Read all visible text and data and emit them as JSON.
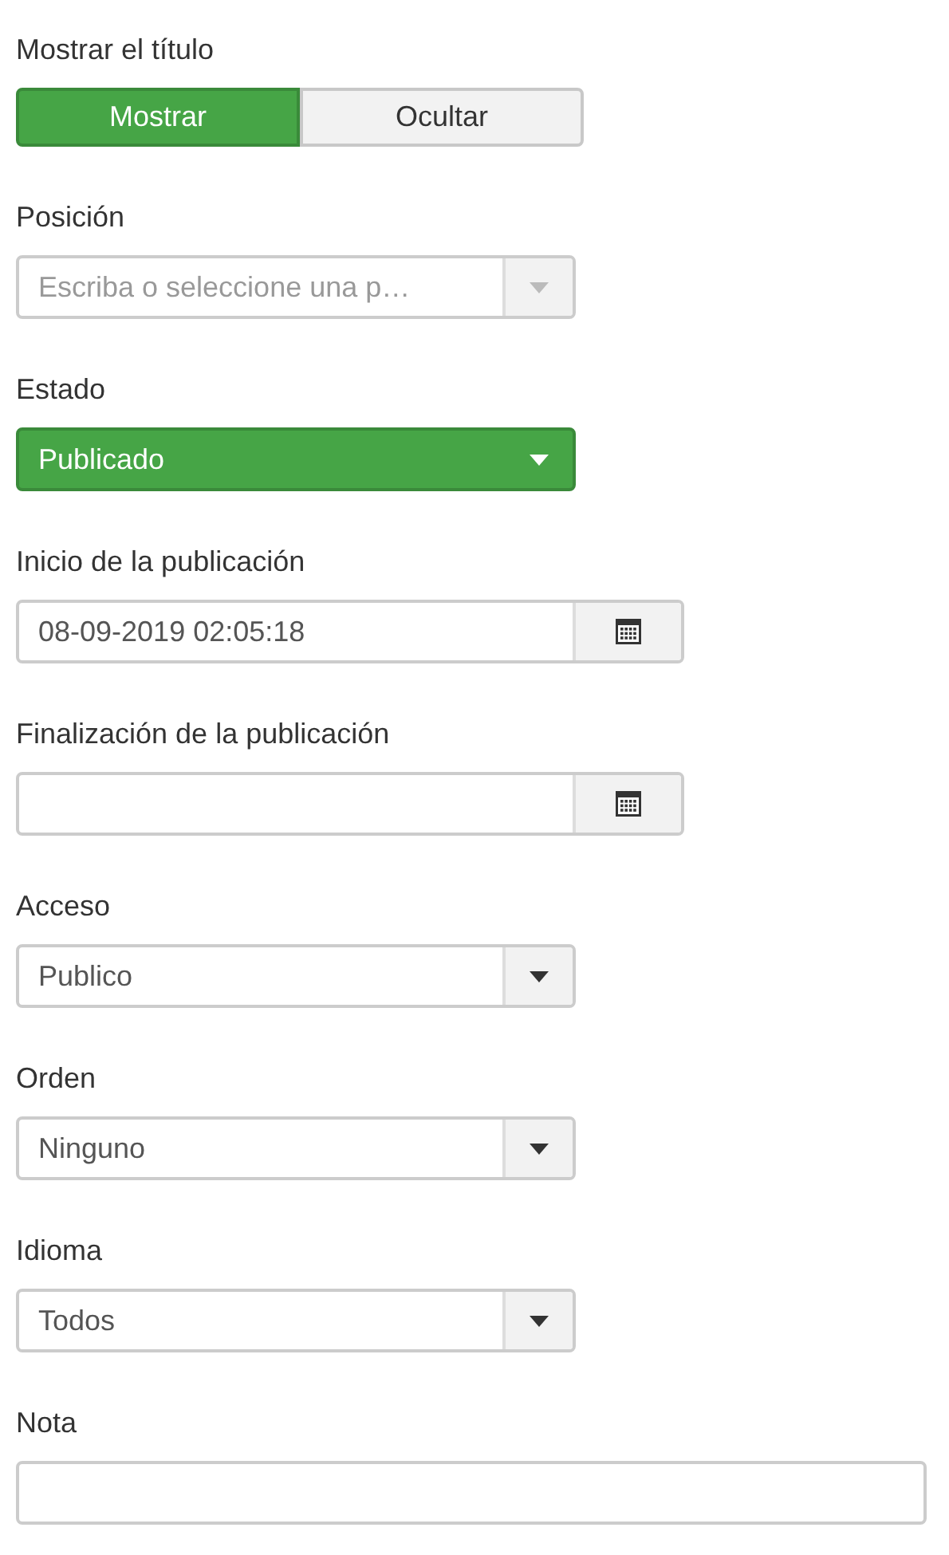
{
  "fields": [
    {
      "kind": "toggle",
      "label": "Mostrar el título",
      "options": [
        {
          "label": "Mostrar",
          "selected": true
        },
        {
          "label": "Ocultar",
          "selected": false
        }
      ]
    },
    {
      "kind": "combo",
      "label": "Posición",
      "placeholder": "Escriba o seleccione una p…"
    },
    {
      "kind": "status",
      "label": "Estado",
      "value": "Publicado"
    },
    {
      "kind": "date",
      "label": "Inicio de la publicación",
      "value": "08-09-2019 02:05:18"
    },
    {
      "kind": "date",
      "label": "Finalización de la publicación"
    },
    {
      "kind": "select",
      "label": "Acceso",
      "value": "Publico"
    },
    {
      "kind": "select",
      "label": "Orden",
      "value": "Ninguno"
    },
    {
      "kind": "select",
      "label": "Idioma",
      "value": "Todos"
    },
    {
      "kind": "text",
      "label": "Nota"
    }
  ]
}
